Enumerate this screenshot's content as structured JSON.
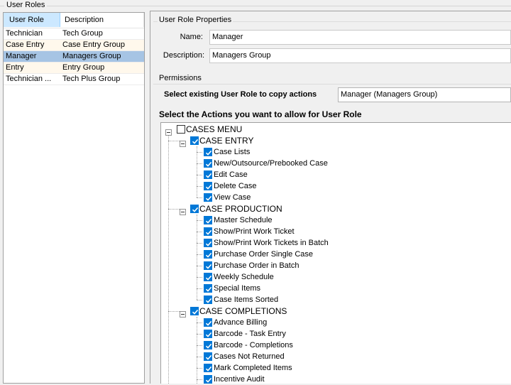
{
  "roles_group": {
    "title": "User Roles"
  },
  "role_list": {
    "headers": {
      "role": "User Role",
      "description": "Description"
    },
    "rows": [
      {
        "role": "Technician",
        "description": "Tech Group"
      },
      {
        "role": "Case Entry",
        "description": "Case Entry Group"
      },
      {
        "role": "Manager",
        "description": "Managers Group"
      },
      {
        "role": "Entry",
        "description": "Entry Group"
      },
      {
        "role": "Technician ...",
        "description": "Tech Plus Group"
      }
    ]
  },
  "properties": {
    "title": "User Role Properties",
    "name_label": "Name:",
    "name_value": "Manager",
    "description_label": "Description:",
    "description_value": "Managers Group"
  },
  "permissions": {
    "title": "Permissions",
    "copy_label": "Select existing User Role to copy actions",
    "copy_value": "Manager (Managers Group)",
    "actions_label": "Select the Actions you want to allow for User Role"
  },
  "tree": {
    "root": "CASES MENU",
    "groups": [
      {
        "label": "CASE ENTRY",
        "items": [
          "Case Lists",
          "New/Outsource/Prebooked Case",
          "Edit Case",
          "Delete Case",
          "View Case"
        ]
      },
      {
        "label": "CASE PRODUCTION",
        "items": [
          "Master Schedule",
          "Show/Print Work Ticket",
          "Show/Print Work Tickets in Batch",
          "Purchase Order Single Case",
          "Purchase Order in Batch",
          "Weekly Schedule",
          "Special Items",
          "Case Items Sorted"
        ]
      },
      {
        "label": "CASE COMPLETIONS",
        "items": [
          "Advance Billing",
          "Barcode - Task Entry",
          "Barcode - Completions",
          "Cases Not Returned",
          "Mark Completed Items",
          "Incentive Audit"
        ]
      }
    ]
  }
}
